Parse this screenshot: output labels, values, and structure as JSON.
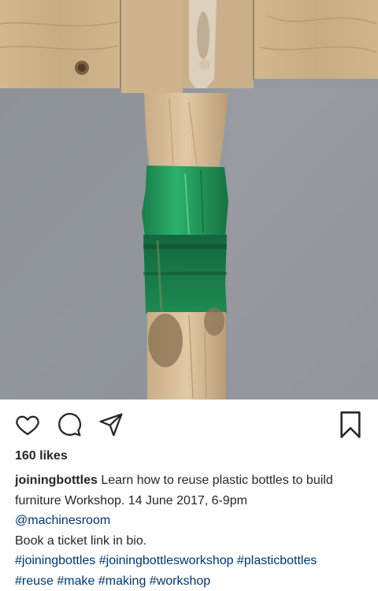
{
  "post": {
    "photo": {
      "icon": "photo-of-green-plastic-bottle-joining-two-wooden-sticks",
      "colors": {
        "wall": "#8f9399",
        "wood": "#c9b08c",
        "bottle_green": "#1f9a5c"
      }
    },
    "actions": {
      "like_icon": "heart-outline-icon",
      "comment_icon": "comment-bubble-icon",
      "share_icon": "paper-plane-icon",
      "save_icon": "bookmark-outline-icon"
    },
    "likes": "160 likes",
    "caption": {
      "username": "joiningbottles",
      "line1_text": "Learn how to reuse plastic bottles to build",
      "line2": "furniture Workshop. 14 June 2017, 6-9pm",
      "mention": "@machinesroom",
      "line4": "Book a ticket link in bio.",
      "hashtags_line1": [
        "#joiningbottles",
        "#joiningbottlesworkshop",
        "#plasticbottles"
      ],
      "hashtags_line2": [
        "#reuse",
        "#make",
        "#making",
        "#workshop"
      ]
    }
  }
}
